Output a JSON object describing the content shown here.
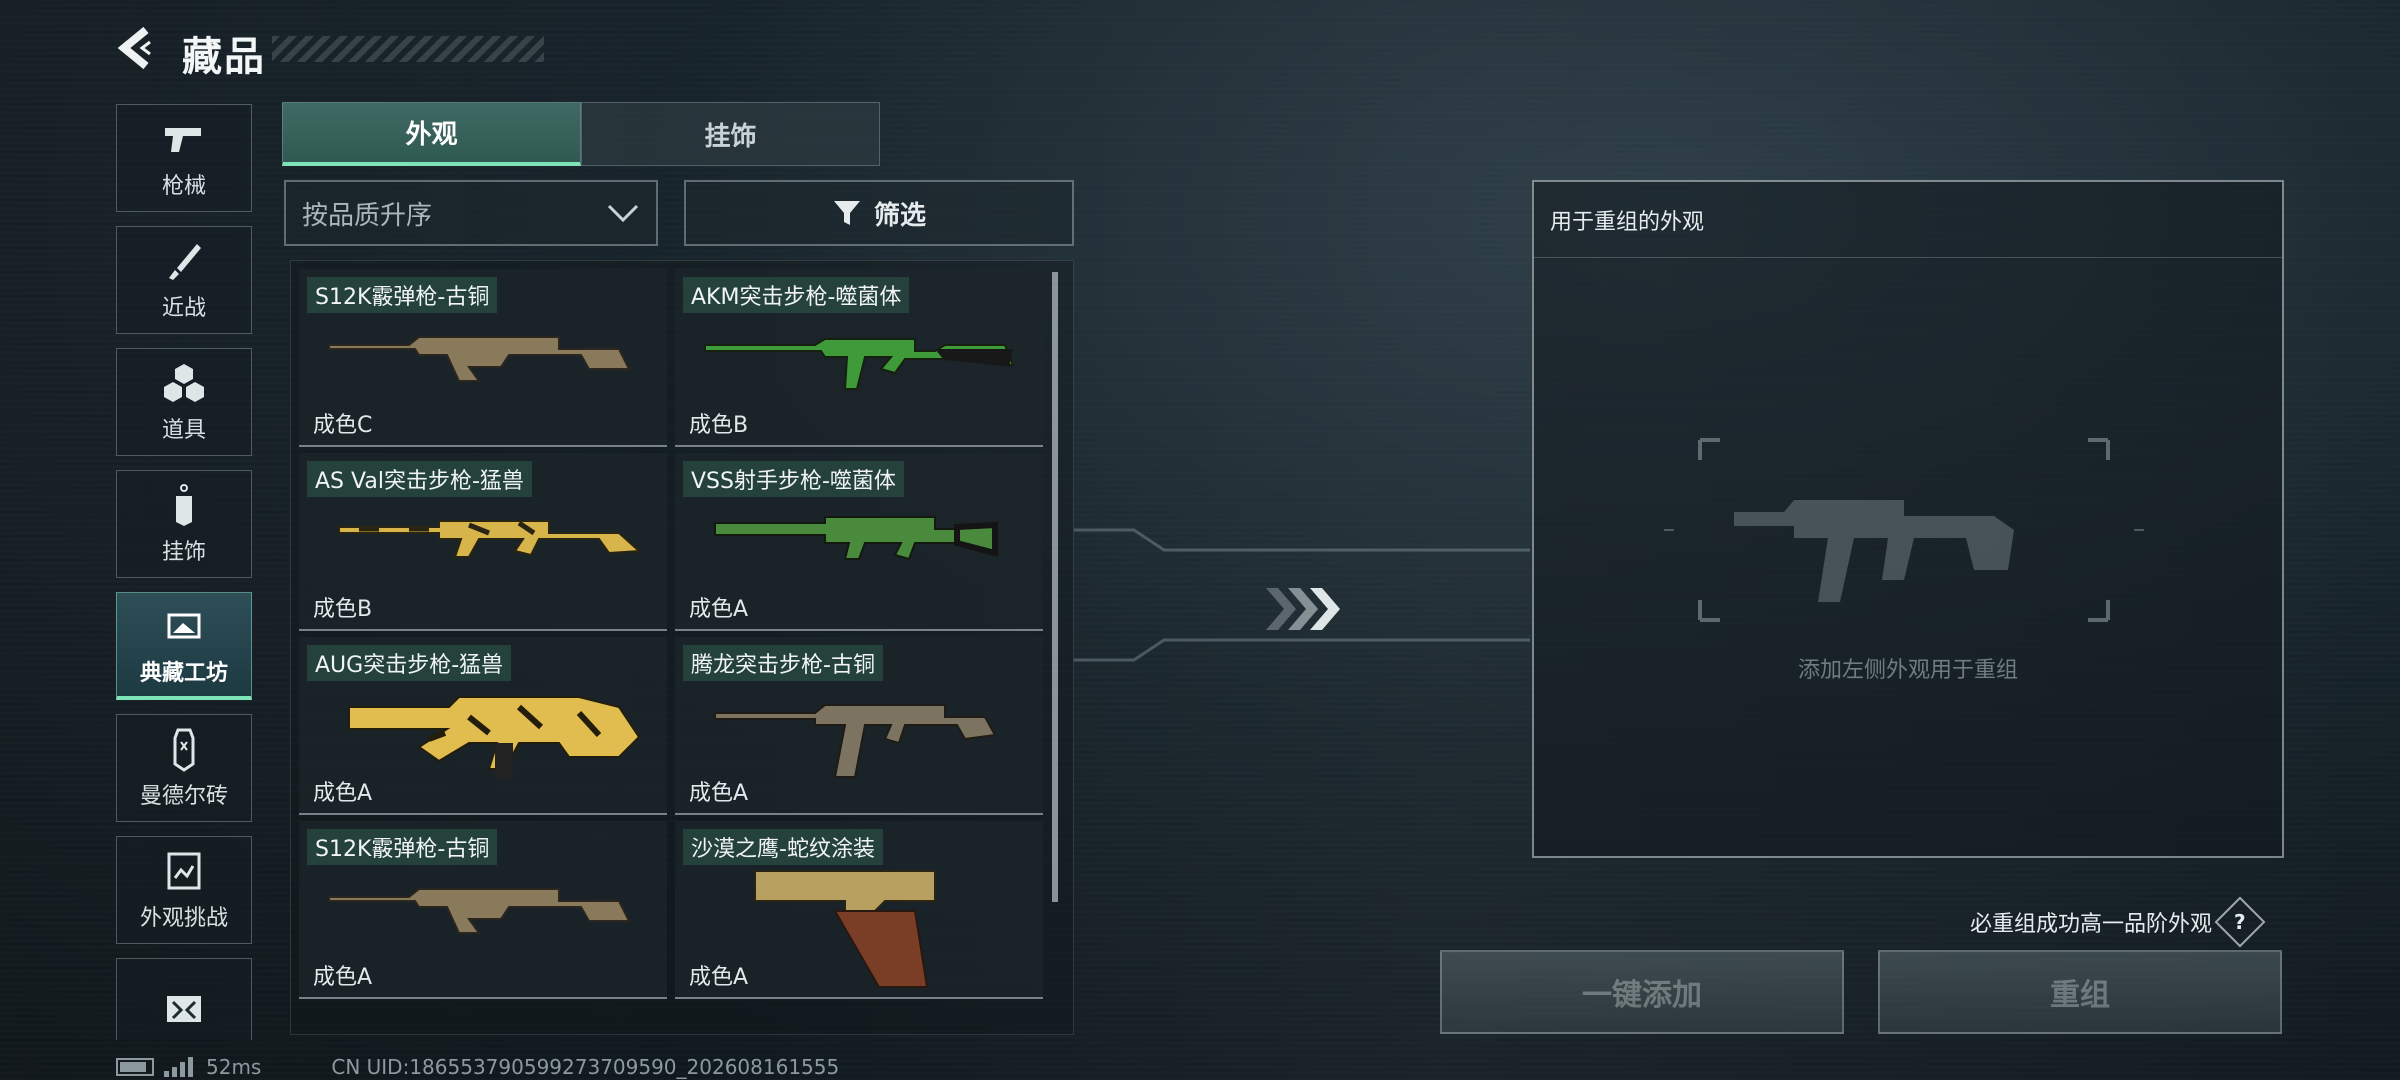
{
  "header": {
    "title": "藏品"
  },
  "nav": {
    "items": [
      {
        "label": "枪械",
        "icon": "pistol-icon"
      },
      {
        "label": "近战",
        "icon": "knife-icon"
      },
      {
        "label": "道具",
        "icon": "cubes-icon"
      },
      {
        "label": "挂饰",
        "icon": "charm-icon"
      },
      {
        "label": "典藏工坊",
        "icon": "workshop-icon",
        "active": true
      },
      {
        "label": "曼德尔砖",
        "icon": "brick-icon"
      },
      {
        "label": "外观挑战",
        "icon": "challenge-icon"
      }
    ]
  },
  "tabs": [
    {
      "label": "外观",
      "active": true
    },
    {
      "label": "挂饰",
      "active": false
    }
  ],
  "sort": {
    "label": "按品质升序"
  },
  "filter": {
    "label": "筛选"
  },
  "items": [
    {
      "name": "S12K霰弹枪-古铜",
      "grade": "成色C",
      "color": "#8a7a5c"
    },
    {
      "name": "AKM突击步枪-噬菌体",
      "grade": "成色B",
      "color": "#3f9a3a"
    },
    {
      "name": "AS Val突击步枪-猛兽",
      "grade": "成色B",
      "color": "#d8b54a"
    },
    {
      "name": "VSS射手步枪-噬菌体",
      "grade": "成色A",
      "color": "#4a8a3c"
    },
    {
      "name": "AUG突击步枪-猛兽",
      "grade": "成色A",
      "color": "#e0bd4e"
    },
    {
      "name": "腾龙突击步枪-古铜",
      "grade": "成色A",
      "color": "#7c7360"
    },
    {
      "name": "S12K霰弹枪-古铜",
      "grade": "成色A",
      "color": "#8a7a5c"
    },
    {
      "name": "沙漠之鹰-蛇纹涂装",
      "grade": "成色A",
      "color": "#b8a060"
    }
  ],
  "reforge": {
    "title": "用于重组的外观",
    "hint": "添加左侧外观用于重组",
    "guarantee": "必重组成功高一品阶外观",
    "help": "?",
    "add_button": "一键添加",
    "reforge_button": "重组"
  },
  "status": {
    "latency": "52ms",
    "uid": "CN UID:186553790599273709590_202608161555"
  }
}
